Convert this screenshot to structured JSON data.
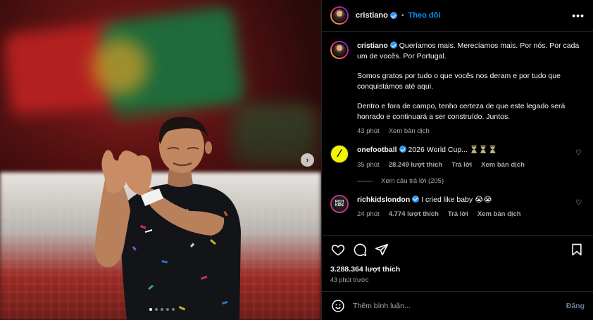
{
  "post": {
    "author": "cristiano",
    "follow_label": "Theo dõi",
    "separator": "•",
    "more_label": "•••",
    "caption": {
      "line1": "Queríamos mais. Merecíamos mais. Por nós. Por cada um de vocês. Por Portugal.",
      "para2": "Somos gratos por tudo o que vocês nos deram e por tudo que conquistámos até aqui.",
      "para3": "Dentro e fora de campo, tenho certeza de que este legado será honrado e continuará a ser construído. Juntos.",
      "time": "43 phút",
      "translate": "Xem bản dịch"
    },
    "comments": [
      {
        "user": "onefootball",
        "text": "2026 World Cup... ⏳⏳⏳",
        "time": "35 phút",
        "likes": "28.249 lượt thích",
        "reply": "Trả lời",
        "translate": "Xem bản dịch",
        "view_replies": "Xem câu trả lời (205)"
      },
      {
        "user": "richkidslondon",
        "text": "I cried like baby 😭😭",
        "time": "24 phút",
        "likes": "4.774 lượt thích",
        "reply": "Trả lời",
        "translate": "Xem bản dịch"
      }
    ],
    "like_count": "3.288.364 lượt thích",
    "posted_ago": "43 phút trước",
    "composer": {
      "placeholder": "Thêm bình luận...",
      "post_label": "Đăng"
    }
  },
  "media": {
    "carousel_total": 5,
    "carousel_active": 1,
    "next_label": "›"
  },
  "colors": {
    "accent": "#0095f6",
    "verified": "#3897f0",
    "muted": "#a8a8a8",
    "background": "#000000"
  }
}
